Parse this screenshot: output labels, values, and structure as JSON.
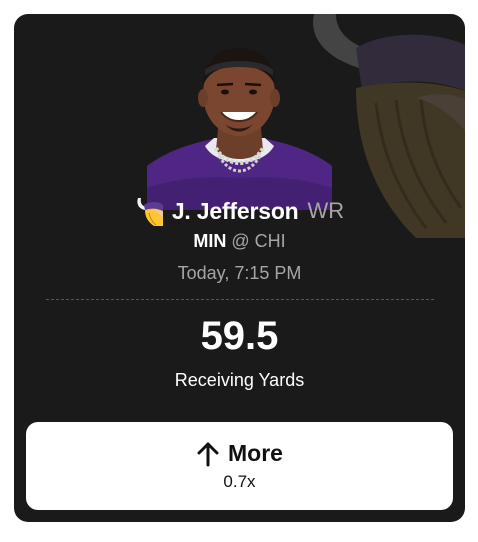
{
  "player": {
    "name": "J. Jefferson",
    "position": "WR"
  },
  "matchup": {
    "team": "MIN",
    "separator": "@",
    "opponent": "CHI"
  },
  "game_time": "Today, 7:15 PM",
  "projection": {
    "line": "59.5",
    "stat": "Receiving Yards"
  },
  "pick_button": {
    "label": "More",
    "multiplier": "0.7x",
    "icon": "arrow-up-icon"
  },
  "colors": {
    "card_background": "#1a1a1a",
    "jersey_purple": "#4f2683",
    "team_gold": "#ffc62f",
    "muted_text": "#a6a6a6",
    "button_background": "#ffffff"
  },
  "icons": {
    "team_logo": "vikings-logo-icon",
    "background_logo": "vikings-logo-watermark"
  }
}
